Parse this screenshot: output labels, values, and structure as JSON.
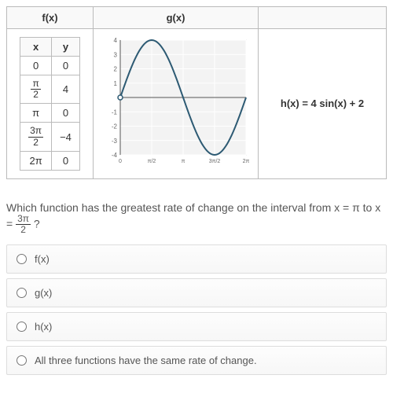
{
  "headers": {
    "fx": "f(x)",
    "gx": "g(x)"
  },
  "fx_table": {
    "cols": {
      "x": "x",
      "y": "y"
    },
    "rows": [
      {
        "x_plain": "0",
        "y": "0"
      },
      {
        "x_num": "π",
        "x_den": "2",
        "y": "4"
      },
      {
        "x_plain": "π",
        "y": "0"
      },
      {
        "x_num": "3π",
        "x_den": "2",
        "y": "−4"
      },
      {
        "x_plain": "2π",
        "y": "0"
      }
    ]
  },
  "hx": "h(x) = 4 sin(x) + 2",
  "question": {
    "prefix": "Which function has the greatest rate of change on the interval from x = π to x = ",
    "frac_num": "3π",
    "frac_den": "2",
    "suffix": " ?"
  },
  "options": {
    "a": "f(x)",
    "b": "g(x)",
    "c": "h(x)",
    "d": "All three functions have the same rate of change."
  },
  "chart_data": {
    "type": "line",
    "title": "g(x)",
    "xlabel": "",
    "ylabel": "",
    "xlim": [
      0,
      6.2832
    ],
    "ylim": [
      -4,
      4
    ],
    "x_ticks": [
      0,
      1.5708,
      3.1416,
      4.7124,
      6.2832
    ],
    "x_tick_labels": [
      "0",
      "π/2",
      "π",
      "3π/2",
      "2π"
    ],
    "y_ticks": [
      -4,
      -3,
      -2,
      -1,
      0,
      1,
      2,
      3,
      4
    ],
    "series": [
      {
        "name": "g(x)",
        "x": [
          0,
          0.3927,
          0.7854,
          1.1781,
          1.5708,
          1.9635,
          2.3562,
          2.7489,
          3.1416,
          3.5343,
          3.927,
          4.3197,
          4.7124,
          5.1051,
          5.4978,
          5.8905,
          6.2832
        ],
        "y": [
          0,
          1.53,
          2.83,
          3.7,
          4.0,
          3.7,
          2.83,
          1.53,
          0,
          -1.53,
          -2.83,
          -3.7,
          -4.0,
          -3.7,
          -2.83,
          -1.53,
          0
        ]
      }
    ],
    "function_hint": "g(x) = 4 sin(x)"
  }
}
